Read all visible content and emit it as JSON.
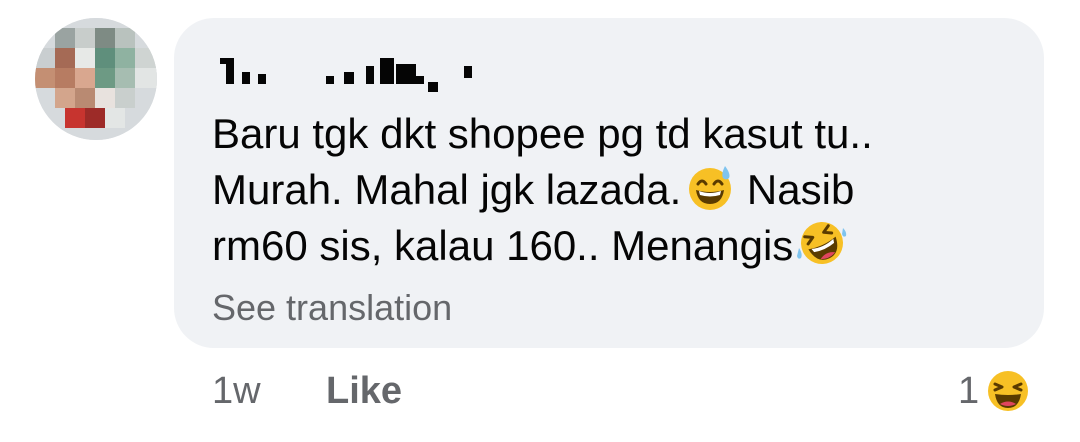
{
  "comment": {
    "author_obscured": true,
    "lines": [
      "Baru tgk dkt shopee pg td kasut tu..",
      "Murah. Mahal jgk lazada.",
      "Nasib",
      "rm60 sis, kalau 160.. Menangis"
    ],
    "emojis": [
      "grinning-sweat-icon",
      "rolling-laughing-icon"
    ],
    "see_translation": "See translation"
  },
  "actions": {
    "time": "1w",
    "like_label": "Like"
  },
  "reactions": {
    "count": "1",
    "icon": "haha-icon",
    "colors": {
      "bubble_bg": "#f0f2f5",
      "meta_text": "#65676b",
      "emoji_yellow": "#f7c025"
    }
  }
}
